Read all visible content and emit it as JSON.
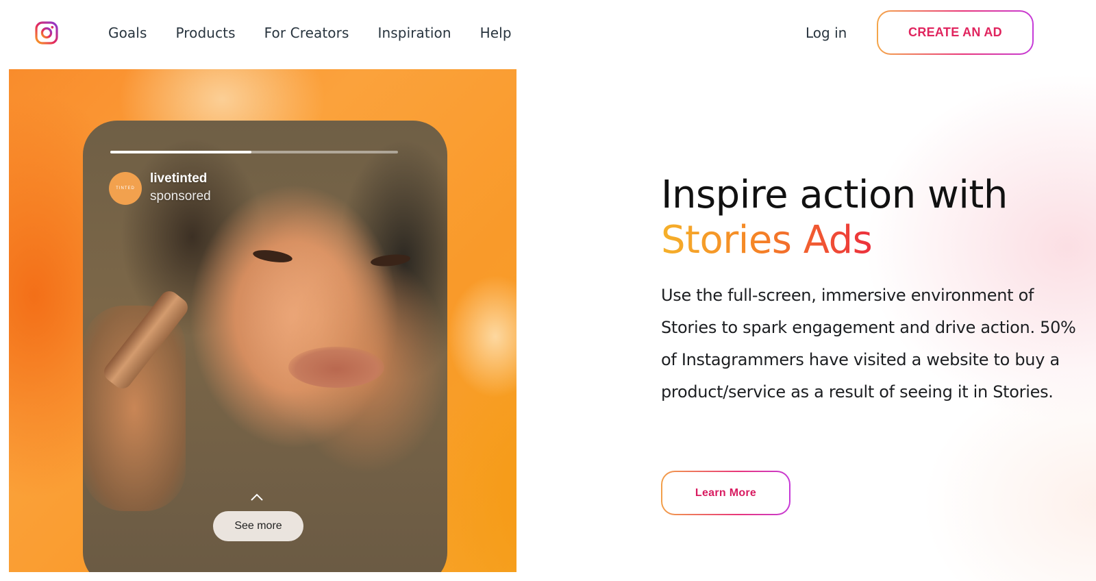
{
  "header": {
    "logo_icon": "instagram-icon",
    "nav": [
      {
        "label": "Goals"
      },
      {
        "label": "Products"
      },
      {
        "label": "For Creators"
      },
      {
        "label": "Inspiration"
      },
      {
        "label": "Help"
      }
    ],
    "login_label": "Log in",
    "cta_label": "CREATE AN AD"
  },
  "story": {
    "progress": 0.49,
    "brand_name": "livetinted",
    "brand_sub": "sponsored",
    "brand_avatar_text": "TINTED",
    "see_more_label": "See more",
    "chevron_icon": "chevron-up-icon"
  },
  "hero": {
    "headline_line1": "Inspire action with",
    "headline_accent": "Stories Ads",
    "body": "Use the full-screen, immersive environment of Stories to spark engagement and drive action. 50% of Instagrammers have visited a website to buy a product/service as a result of seeing it in Stories.",
    "learn_more_label": "Learn More"
  },
  "colors": {
    "cta_text": "#e0245e",
    "accent_gradient": [
      "#f5b12a",
      "#f58526",
      "#ec2f3d"
    ],
    "media_bg": "#f98c2c"
  }
}
